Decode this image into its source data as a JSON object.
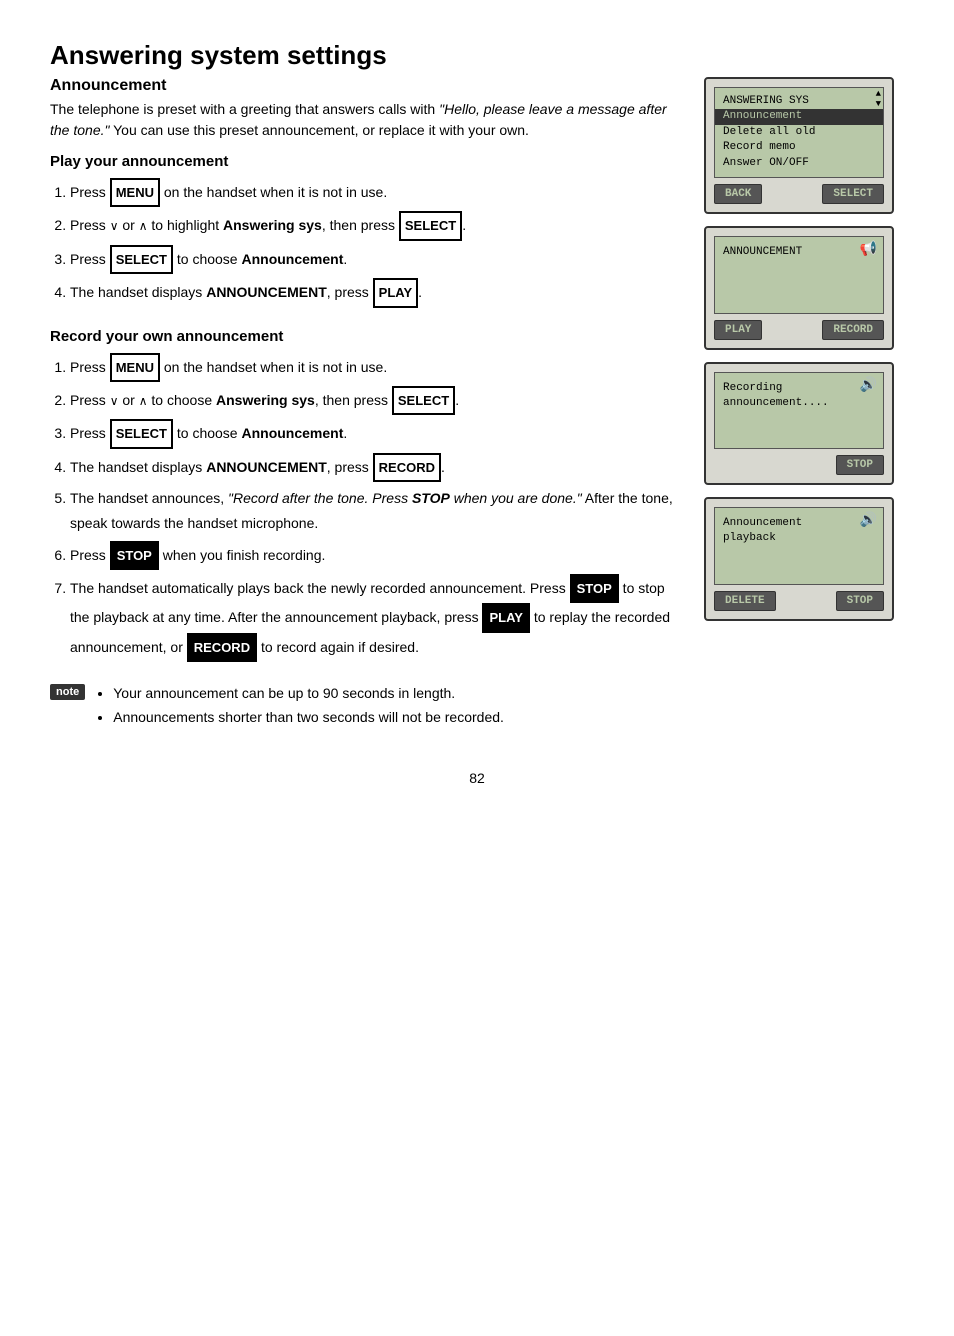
{
  "page": {
    "title": "Answering system settings",
    "subtitle": "Announcement",
    "intro_text_normal": "The telephone is preset with a greeting that answers calls with ",
    "intro_italic": "\"Hello, please leave a message after the tone.\"",
    "intro_text2": "  You can use this preset announcement, or replace it with your own.",
    "section1_title": "Play your announcement",
    "section1_steps": [
      "Press <MENU> on the handset when it is not in use.",
      "Press ∨ or ∧ to highlight <b>Answering sys</b>, then press <SELECT>.",
      "Press <SELECT> to choose <b>Announcement</b>.",
      "The handset displays <b>ANNOUNCEMENT</b>, press <PLAY>."
    ],
    "section2_title": "Record your own announcement",
    "section2_steps": [
      "Press <MENU> on the handset when it is not in use.",
      "Press ∨ or ∧ to choose <b>Answering sys</b>, then press <SELECT>.",
      "Press <SELECT> to choose <b>Announcement</b>.",
      "The handset displays <b>ANNOUNCEMENT</b>, press <RECORD>.",
      "The handset announces, <i>\"Record after the tone. Press <b>STOP</b> when you are done.\"</i>  After the tone, speak towards the handset microphone.",
      "Press <STOP> when you finish recording.",
      "The handset automatically plays back the newly recorded announcement. Press <STOP> to stop the playback at any time. After the announcement playback, press <PLAY> to replay the recorded announcement, or <RECORD> to record again if desired."
    ],
    "note_label": "note",
    "note_items": [
      "Your announcement can be up to 90 seconds in length.",
      "Announcements shorter than two seconds will not be recorded."
    ],
    "page_number": "82",
    "devices": [
      {
        "id": "device1",
        "has_scroll": true,
        "screen_lines": [
          {
            "text": "ANSWERING SYS",
            "highlight": false
          },
          {
            "text": "Announcement",
            "highlight": true
          },
          {
            "text": "Delete all old",
            "highlight": false
          },
          {
            "text": "Record memo",
            "highlight": false
          },
          {
            "text": "Answer ON/OFF",
            "highlight": false
          }
        ],
        "buttons": [
          {
            "label": "BACK"
          },
          {
            "label": "SELECT"
          }
        ]
      },
      {
        "id": "device2",
        "has_speaker": true,
        "screen_lines": [
          {
            "text": "ANNOUNCEMENT",
            "highlight": false
          },
          {
            "text": "",
            "highlight": false
          },
          {
            "text": "",
            "highlight": false
          },
          {
            "text": "",
            "highlight": false
          }
        ],
        "buttons": [
          {
            "label": "PLAY"
          },
          {
            "label": "RECORD"
          }
        ]
      },
      {
        "id": "device3",
        "has_speaker": true,
        "screen_lines": [
          {
            "text": "Recording",
            "highlight": false
          },
          {
            "text": "announcement....",
            "highlight": false
          },
          {
            "text": "",
            "highlight": false
          },
          {
            "text": "",
            "highlight": false
          }
        ],
        "buttons": [
          {
            "label": "STOP"
          }
        ]
      },
      {
        "id": "device4",
        "has_speaker": true,
        "screen_lines": [
          {
            "text": "Announcement",
            "highlight": false
          },
          {
            "text": "  playback",
            "highlight": false
          },
          {
            "text": "",
            "highlight": false
          },
          {
            "text": "",
            "highlight": false
          }
        ],
        "buttons": [
          {
            "label": "DELETE"
          },
          {
            "label": "STOP"
          }
        ]
      }
    ]
  }
}
